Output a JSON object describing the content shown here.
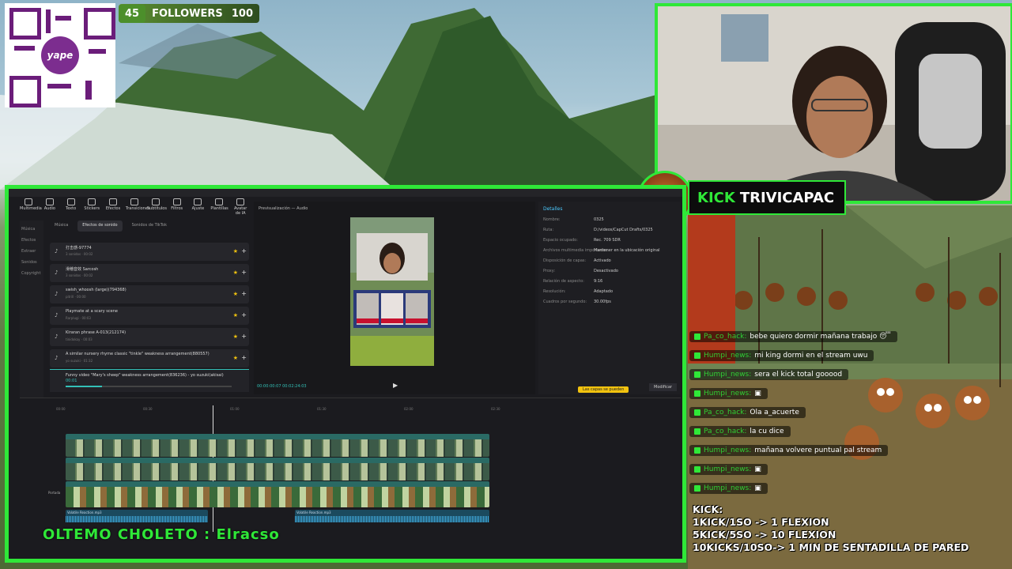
{
  "overlay": {
    "followers": {
      "current": "45",
      "label": "FOLLOWERS",
      "goal": "100"
    },
    "qr_label": "yape",
    "kick_badge": {
      "brand": "KICK",
      "channel": "TRIVICAPAC"
    },
    "ticker": "OLTEMO CHOLETO : Elracso",
    "kick_rules": {
      "title": "KICK:",
      "lines": [
        "1KICK/1SO -> 1 FLEXION",
        "5KICK/5SO -> 10 FLEXION",
        "10KICKS/10SO-> 1 MIN DE SENTADILLA DE PARED"
      ]
    },
    "chat": [
      {
        "user": "Pa_co_hack:",
        "text": "bebe quiero dormir mañana trabajo 😴"
      },
      {
        "user": "Humpi_news:",
        "text": "mi king dormi en el stream uwu"
      },
      {
        "user": "Humpi_news:",
        "text": "sera el kick total gooood"
      },
      {
        "user": "Humpi_news:",
        "text": "▣"
      },
      {
        "user": "Pa_co_hack:",
        "text": "Ola a_acuerte"
      },
      {
        "user": "Pa_co_hack:",
        "text": "la cu dice"
      },
      {
        "user": "Humpi_news:",
        "text": "mañana volvere puntual pal stream"
      },
      {
        "user": "Humpi_news:",
        "text": "▣"
      },
      {
        "user": "Humpi_news:",
        "text": "▣"
      }
    ]
  },
  "editor": {
    "toolbar": [
      "Multimedia",
      "Audio",
      "Texto",
      "Stickers",
      "Efectos",
      "Transiciones",
      "Subtítulos",
      "Filtros",
      "Ajuste",
      "Plantillas",
      "Avatar de IA"
    ],
    "left_nav": [
      "Música",
      "Efectos",
      "Extraer",
      "Sonidos",
      "Copyright"
    ],
    "sfx_tabs": [
      "Música",
      "Efectos de sonido",
      "Sonidos de TikTok"
    ],
    "sfx": [
      {
        "name": "打击感-97774",
        "sub": "3 sonidos · 00:02"
      },
      {
        "name": "滑稽音效 Sarcosh",
        "sub": "3 sonidos · 00:02"
      },
      {
        "name": "swish_whoosh (large)(794368)",
        "sub": "pitrill · 00:00"
      },
      {
        "name": "Playmate at a scary scene",
        "sub": "Rarplugi · 00:03"
      },
      {
        "name": "Kiraran phrase A-013(212174)",
        "sub": "tinidokay · 00:03"
      },
      {
        "name": "A similar nursery rhyme classic \"tinkle\" weakness arrangement(880557)",
        "sub": "yo suzuki · 01:32"
      }
    ],
    "now_playing": "Funny video \"Mary's sheep\" weakness arrangement(836236) - yo suzuki(akisai)",
    "now_time": "00:01",
    "preview_title": "Previsualización — Audio",
    "timecode": "00:00:00:07  00:02:24:03",
    "details": {
      "header": "Detalles",
      "rows": [
        {
          "k": "Nombre:",
          "v": "0325"
        },
        {
          "k": "Ruta:",
          "v": "D:/videos/CapCut Drafts/0325"
        },
        {
          "k": "Espacio ocupado:",
          "v": "Rec. 709 SDR"
        },
        {
          "k": "Archivos multimedia importados:",
          "v": "Mantener en la ubicación original"
        },
        {
          "k": "Disposición de capas:",
          "v": "Activado"
        },
        {
          "k": "Proxy:",
          "v": "Desactivado"
        },
        {
          "k": "Relación de aspecto:",
          "v": "9:16"
        },
        {
          "k": "Resolución:",
          "v": "Adaptado"
        },
        {
          "k": "Cuadros por segundo:",
          "v": "30.00fps"
        }
      ],
      "modify": "Modificar",
      "warning": "Las capas se pueden"
    },
    "tracks": {
      "v1": "clip_0988888888 .mp4  00:01:38:27",
      "v2": "clip_0988888888 .mp4  00:01:38:27",
      "v3": "cartoon_placement_image_puncapac(capcut.ro)  00:00:48:15",
      "a1": "Volatile Reaction.mp3",
      "a2": "Volatile Reaction.mp3"
    },
    "ruler": [
      "00:00",
      "00:30",
      "01:00",
      "01:30",
      "02:00",
      "02:30"
    ],
    "portada": "Portada"
  },
  "colors": {
    "accent": "#2fe838",
    "teal": "#33c0b7",
    "star": "#f2c30f"
  }
}
